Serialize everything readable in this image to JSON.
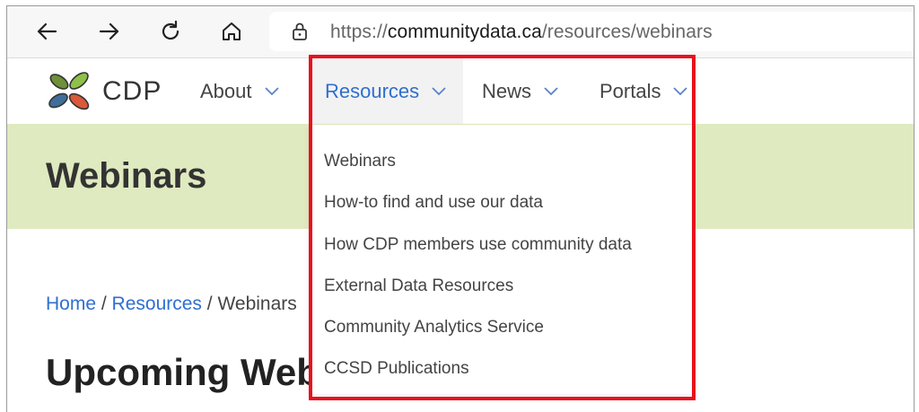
{
  "browser": {
    "url_scheme": "https://",
    "url_host": "communitydata.ca",
    "url_path": "/resources/webinars"
  },
  "site": {
    "brand": "CDP",
    "nav": [
      {
        "label": "About"
      },
      {
        "label": "Resources"
      },
      {
        "label": "News"
      },
      {
        "label": "Portals"
      }
    ]
  },
  "dropdown": {
    "items": [
      "Webinars",
      "How-to find and use our data",
      "How CDP members use community data",
      "External Data Resources",
      "Community Analytics Service",
      "CCSD Publications"
    ]
  },
  "hero": {
    "title": "Webinars"
  },
  "breadcrumb": {
    "home": "Home",
    "sep1": " / ",
    "resources": "Resources",
    "sep2": " / ",
    "current": "Webinars"
  },
  "section": {
    "title": "Upcoming Webinars"
  },
  "colors": {
    "accent": "#2f6fd0",
    "hero_bg": "#dfeac0",
    "highlight": "#e8101c"
  }
}
